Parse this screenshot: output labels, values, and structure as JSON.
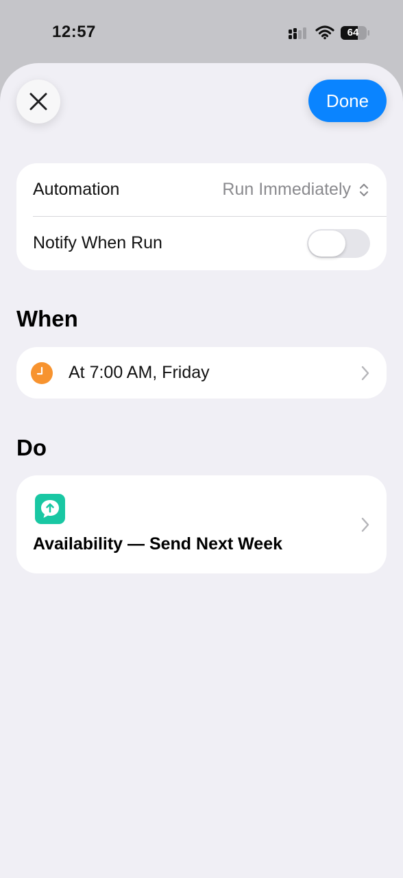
{
  "status_bar": {
    "time": "12:57",
    "battery": "64",
    "icons": [
      "signal-icon",
      "wifi-icon",
      "battery-icon"
    ]
  },
  "header": {
    "close_icon": "close-icon",
    "done_label": "Done"
  },
  "settings": {
    "automation_label": "Automation",
    "automation_value": "Run Immediately",
    "notify_label": "Notify When Run",
    "notify_enabled": false
  },
  "when": {
    "title": "When",
    "trigger_text": "At 7:00 AM, Friday",
    "icon": "clock-icon"
  },
  "do": {
    "title": "Do",
    "action_text": "Availability — Send Next Week",
    "icon": "message-upload-icon"
  },
  "colors": {
    "accent": "#0a84ff",
    "sheet_background": "#f0eff5",
    "clock": "#f7932f",
    "action_icon": "#19c7a3"
  }
}
